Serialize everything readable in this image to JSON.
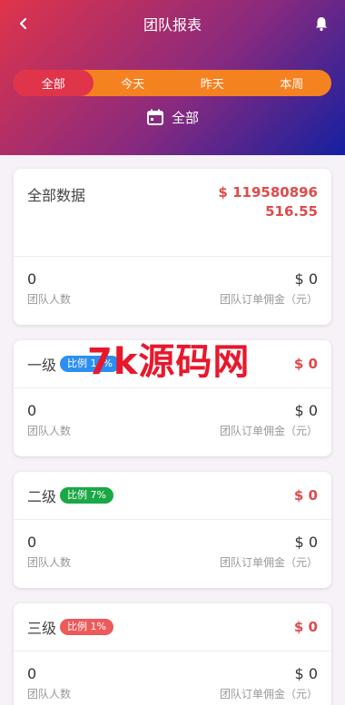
{
  "header": {
    "title": "团队报表",
    "tabs": [
      "全部",
      "今天",
      "昨天",
      "本周"
    ],
    "active_tab": 0,
    "date_label": "全部"
  },
  "summary": {
    "title": "全部数据",
    "amount": "$ 119580896516.55",
    "members_value": "0",
    "members_label": "团队人数",
    "commission_value": "$ 0",
    "commission_label": "团队订单佣金（元）"
  },
  "levels": [
    {
      "title": "一级",
      "badge": "比例 14%",
      "badge_color": "#2b8ff0",
      "amount": "$ 0",
      "members_value": "0",
      "members_label": "团队人数",
      "commission_value": "$ 0",
      "commission_label": "团队订单佣金（元）"
    },
    {
      "title": "二级",
      "badge": "比例 7%",
      "badge_color": "#1aa845",
      "amount": "$ 0",
      "members_value": "0",
      "members_label": "团队人数",
      "commission_value": "$ 0",
      "commission_label": "团队订单佣金（元）"
    },
    {
      "title": "三级",
      "badge": "比例 1%",
      "badge_color": "#ec5a5a",
      "amount": "$ 0",
      "members_value": "0",
      "members_label": "团队人数",
      "commission_value": "$ 0",
      "commission_label": "团队订单佣金（元）"
    }
  ],
  "watermark": "7k源码网",
  "colors": {
    "accent_red": "#e04a4a",
    "tab_orange": "#f58220",
    "tab_active": "#e0344a"
  }
}
